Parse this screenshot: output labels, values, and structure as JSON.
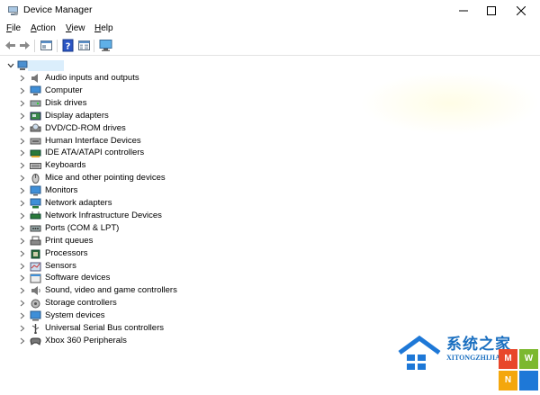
{
  "window": {
    "title": "Device Manager",
    "buttons": [
      "minimize",
      "maximize",
      "close"
    ]
  },
  "menu": {
    "items": [
      {
        "label": "File",
        "accel": "F"
      },
      {
        "label": "Action",
        "accel": "A"
      },
      {
        "label": "View",
        "accel": "V"
      },
      {
        "label": "Help",
        "accel": "H"
      }
    ]
  },
  "toolbar": {
    "buttons": [
      "back-icon",
      "forward-icon",
      "properties-icon",
      "help-icon",
      "view-icon",
      "monitor-icon"
    ]
  },
  "tree": {
    "root_expanded": true,
    "categories": [
      {
        "label": "Audio inputs and outputs",
        "icon": "speaker-icon"
      },
      {
        "label": "Computer",
        "icon": "computer-icon"
      },
      {
        "label": "Disk drives",
        "icon": "disk-drive-icon"
      },
      {
        "label": "Display adapters",
        "icon": "display-adapter-icon"
      },
      {
        "label": "DVD/CD-ROM drives",
        "icon": "dvd-drive-icon"
      },
      {
        "label": "Human Interface Devices",
        "icon": "hid-icon"
      },
      {
        "label": "IDE ATA/ATAPI controllers",
        "icon": "ide-controller-icon"
      },
      {
        "label": "Keyboards",
        "icon": "keyboard-icon"
      },
      {
        "label": "Mice and other pointing devices",
        "icon": "mouse-icon"
      },
      {
        "label": "Monitors",
        "icon": "monitor-icon"
      },
      {
        "label": "Network adapters",
        "icon": "network-adapter-icon"
      },
      {
        "label": "Network Infrastructure Devices",
        "icon": "network-infrastructure-icon"
      },
      {
        "label": "Ports (COM & LPT)",
        "icon": "port-icon"
      },
      {
        "label": "Print queues",
        "icon": "printer-icon"
      },
      {
        "label": "Processors",
        "icon": "processor-icon"
      },
      {
        "label": "Sensors",
        "icon": "sensor-icon"
      },
      {
        "label": "Software devices",
        "icon": "software-device-icon"
      },
      {
        "label": "Sound, video and game controllers",
        "icon": "sound-controller-icon"
      },
      {
        "label": "Storage controllers",
        "icon": "storage-controller-icon"
      },
      {
        "label": "System devices",
        "icon": "system-device-icon"
      },
      {
        "label": "Universal Serial Bus controllers",
        "icon": "usb-icon"
      },
      {
        "label": "Xbox 360 Peripherals",
        "icon": "xbox-controller-icon"
      }
    ]
  },
  "watermark": {
    "brand": "系统之家",
    "site": "XITONGZHIJIA.NET",
    "tiles": [
      "M",
      "W",
      "N",
      ""
    ],
    "tile_colors": [
      "#e8462a",
      "#7cb82f",
      "#f4a70d",
      "#1e78d7"
    ]
  }
}
